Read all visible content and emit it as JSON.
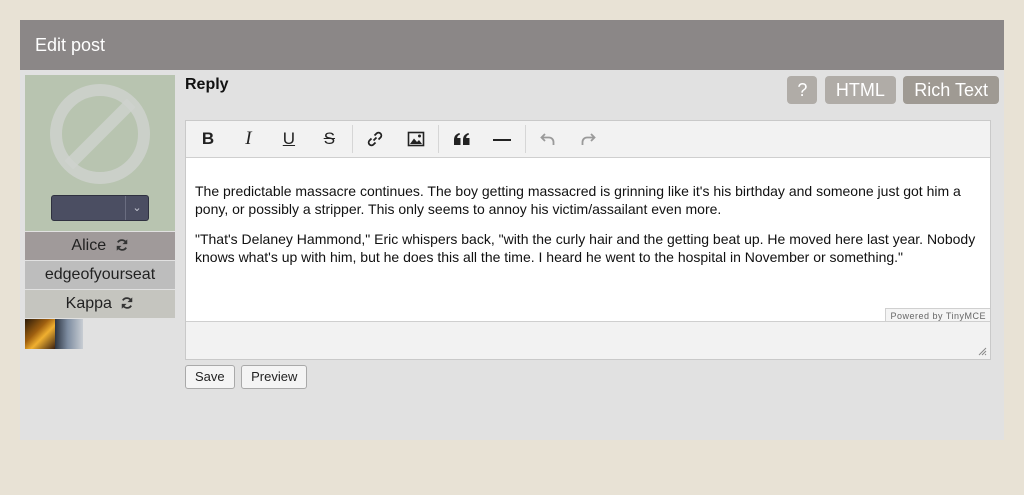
{
  "panel": {
    "title": "Edit post"
  },
  "left": {
    "avatar_select_value": "",
    "names": [
      {
        "label": "Alice",
        "refresh": true
      },
      {
        "label": "edgeofyourseat",
        "refresh": false
      },
      {
        "label": "Kappa",
        "refresh": true
      }
    ]
  },
  "reply": {
    "title": "Reply",
    "mode_buttons": {
      "help": "?",
      "html": "HTML",
      "rich": "Rich Text"
    }
  },
  "editor": {
    "toolbar": {
      "bold": "B",
      "italic": "I",
      "underline": "U",
      "strike": "S"
    },
    "paragraphs": [
      "The predictable massacre continues. The boy getting massacred is grinning like it's his birthday and someone just got him a pony, or possibly a stripper. This only seems to annoy his victim/assailant even more.",
      "\"That's Delaney Hammond,\" Eric whispers back, \"with the curly hair and the getting beat up. He moved here last year. Nobody knows what's up with him, but he does this all the time. I heard he went to the hospital in November or something.\""
    ],
    "powered_by": "Powered by TinyMCE"
  },
  "actions": {
    "save": "Save",
    "preview": "Preview"
  },
  "colors": {
    "header": "#8b8787",
    "panel": "#e1e1e1",
    "page": "#e8e2d5"
  }
}
